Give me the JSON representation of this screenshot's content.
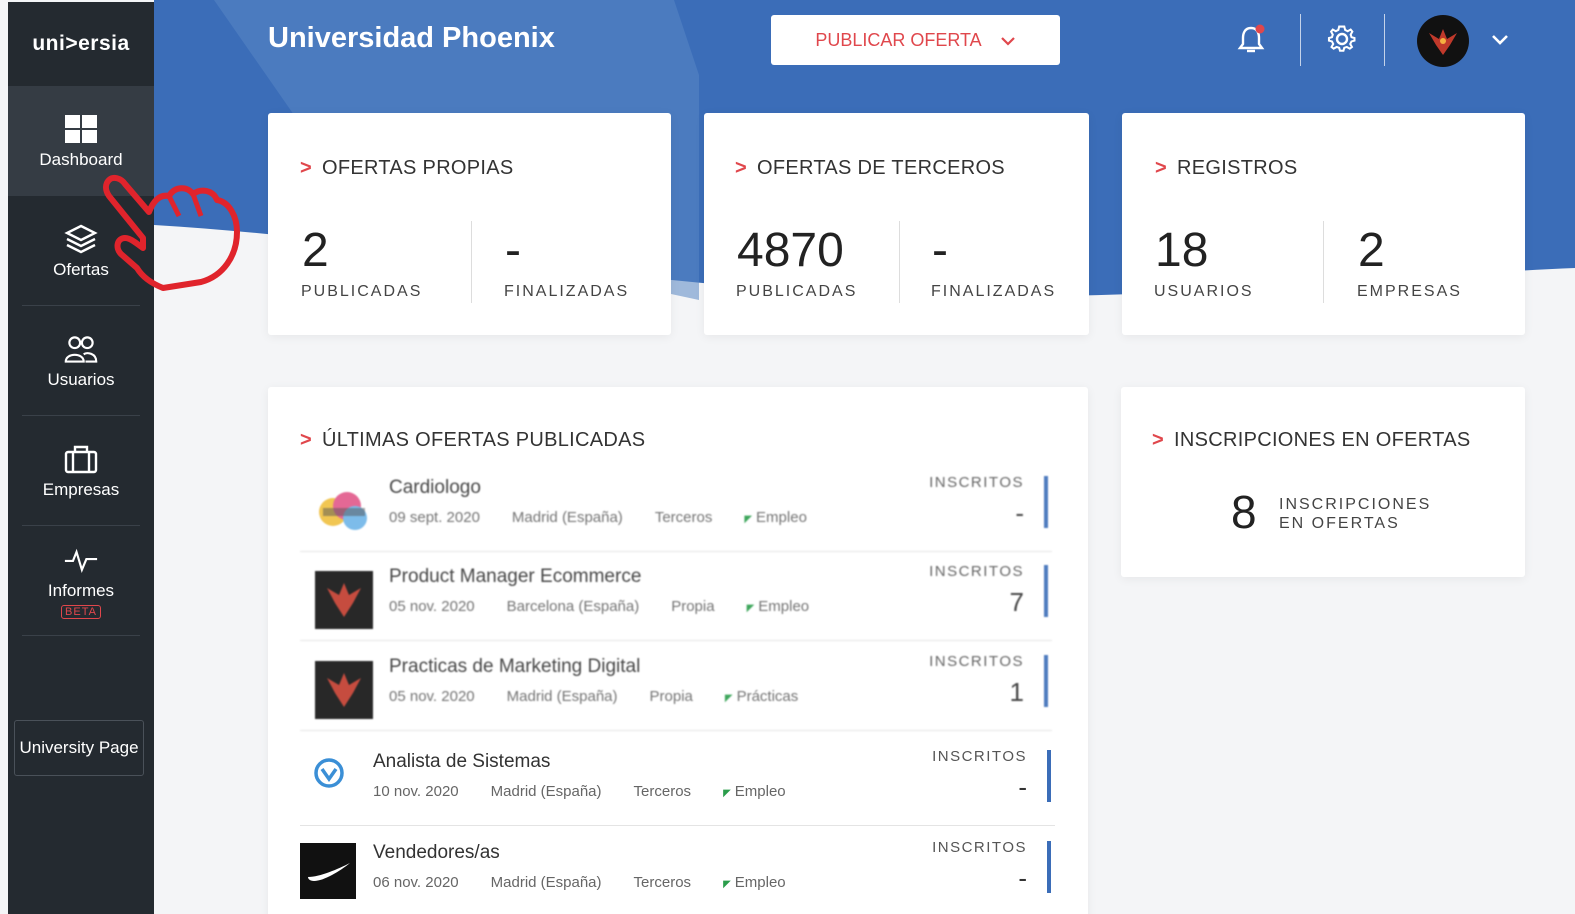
{
  "sidebar": {
    "logo": "uni>ersia",
    "items": [
      {
        "label": "Dashboard"
      },
      {
        "label": "Ofertas"
      },
      {
        "label": "Usuarios"
      },
      {
        "label": "Empresas"
      },
      {
        "label": "Informes",
        "badge": "BETA"
      }
    ],
    "university_page": "University Page"
  },
  "header": {
    "title": "Universidad Phoenix",
    "publish_button": "PUBLICAR OFERTA"
  },
  "cards": {
    "propias": {
      "title": "OFERTAS PROPIAS",
      "v1": "2",
      "l1": "PUBLICADAS",
      "v2": "-",
      "l2": "FINALIZADAS"
    },
    "terceros": {
      "title": "OFERTAS DE TERCEROS",
      "v1": "4870",
      "l1": "PUBLICADAS",
      "v2": "-",
      "l2": "FINALIZADAS"
    },
    "registros": {
      "title": "REGISTROS",
      "v1": "18",
      "l1": "USUARIOS",
      "v2": "2",
      "l2": "EMPRESAS"
    }
  },
  "latest": {
    "title": "ÚLTIMAS OFERTAS PUBLICADAS",
    "offers": [
      {
        "title": "Cardiologo",
        "date": "09 sept. 2020",
        "location": "Madrid (España)",
        "origin": "Terceros",
        "type": "Empleo",
        "ins_label": "INSCRITOS",
        "ins": "-"
      },
      {
        "title": "Product Manager Ecommerce",
        "date": "05 nov. 2020",
        "location": "Barcelona (España)",
        "origin": "Propia",
        "type": "Empleo",
        "ins_label": "INSCRITOS",
        "ins": "7"
      },
      {
        "title": "Practicas de Marketing Digital",
        "date": "05 nov. 2020",
        "location": "Madrid (España)",
        "origin": "Propia",
        "type": "Prácticas",
        "ins_label": "INSCRITOS",
        "ins": "1"
      },
      {
        "title": "Analista de Sistemas",
        "date": "10 nov. 2020",
        "location": "Madrid (España)",
        "origin": "Terceros",
        "type": "Empleo",
        "ins_label": "INSCRITOS",
        "ins": "-"
      },
      {
        "title": "Vendedores/as",
        "date": "06 nov. 2020",
        "location": "Madrid (España)",
        "origin": "Terceros",
        "type": "Empleo",
        "ins_label": "INSCRITOS",
        "ins": "-"
      }
    ]
  },
  "inscripciones": {
    "title": "INSCRIPCIONES EN OFERTAS",
    "value": "8",
    "label1": "INSCRIPCIONES",
    "label2": "EN OFERTAS"
  },
  "icons": [
    "dashboard-icon",
    "layers-icon",
    "users-icon",
    "briefcase-icon",
    "pulse-icon",
    "bell-icon",
    "gear-icon",
    "chevron-down-icon",
    "pointing-hand-icon"
  ],
  "colors": {
    "sidebar": "#242a30",
    "header": "#3b6db8",
    "accent": "#e0474c"
  }
}
